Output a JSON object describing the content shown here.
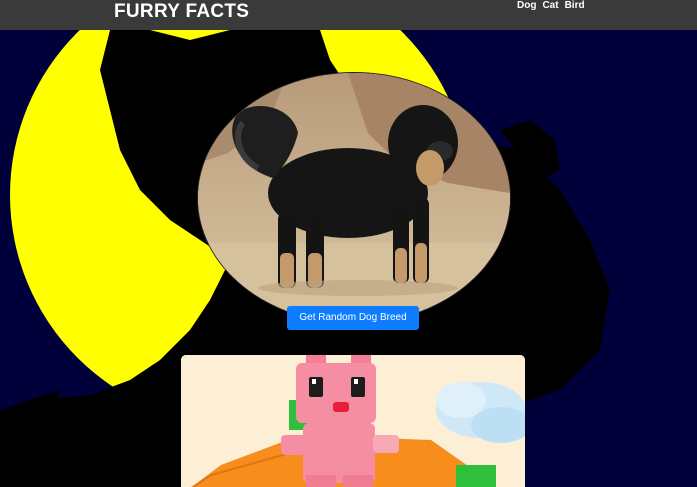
{
  "navbar": {
    "brand": "FURRY FACTS",
    "links": [
      "Dog",
      "Cat",
      "Bird"
    ]
  },
  "main": {
    "button_label": "Get Random Dog Breed"
  },
  "colors": {
    "navbar_bg": "#3a3a3a",
    "moon": "#ffff00",
    "sky": "#00003a",
    "button": "#0d7cff",
    "card_bg": "#fdeed6"
  },
  "icons": {
    "hero_background": "wolf-howling-at-moon-illustration",
    "dog_image": "black-tan-mastiff-photo",
    "game_preview": "pink-block-bunny-character"
  }
}
